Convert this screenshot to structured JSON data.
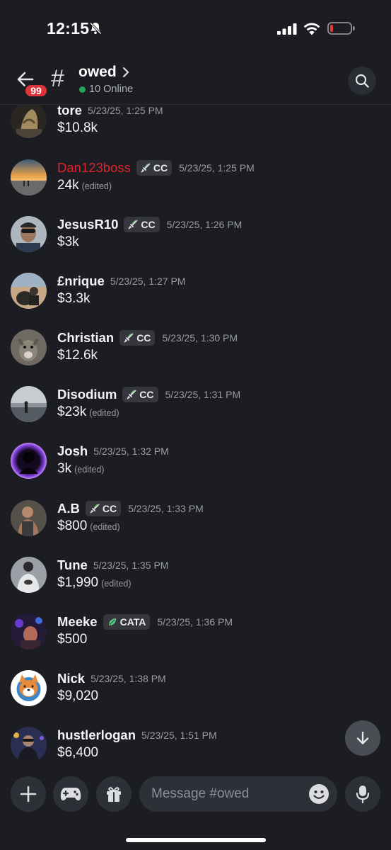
{
  "status_bar": {
    "time": "12:15"
  },
  "header": {
    "unread_badge": "99",
    "channel_name": "owed",
    "online_text": "10 Online"
  },
  "messages": [
    {
      "username": "tore",
      "name_color": "#f2f3f5",
      "tag": "",
      "timestamp": "5/23/25, 1:25 PM",
      "content": "$10.8k",
      "edited": ""
    },
    {
      "username": "Dan123boss",
      "name_color": "#e4212b",
      "tag": "CC",
      "timestamp": "5/23/25, 1:25 PM",
      "content": "24k",
      "edited": "(edited)"
    },
    {
      "username": "JesusR10",
      "name_color": "#f2f3f5",
      "tag": "CC",
      "timestamp": "5/23/25, 1:26 PM",
      "content": "$3k",
      "edited": ""
    },
    {
      "username": "£nrique",
      "name_color": "#f2f3f5",
      "tag": "",
      "timestamp": "5/23/25, 1:27 PM",
      "content": "$3.3k",
      "edited": ""
    },
    {
      "username": "Christian",
      "name_color": "#f2f3f5",
      "tag": "CC",
      "timestamp": "5/23/25, 1:30 PM",
      "content": "$12.6k",
      "edited": ""
    },
    {
      "username": "Disodium",
      "name_color": "#f2f3f5",
      "tag": "CC",
      "timestamp": "5/23/25, 1:31 PM",
      "content": "$23k",
      "edited": "(edited)"
    },
    {
      "username": "Josh",
      "name_color": "#f2f3f5",
      "tag": "",
      "timestamp": "5/23/25, 1:32 PM",
      "content": "3k",
      "edited": "(edited)"
    },
    {
      "username": "A.B",
      "name_color": "#f2f3f5",
      "tag": "CC",
      "timestamp": "5/23/25, 1:33 PM",
      "content": "$800",
      "edited": "(edited)"
    },
    {
      "username": "Tune",
      "name_color": "#f2f3f5",
      "tag": "",
      "timestamp": "5/23/25, 1:35 PM",
      "content": "$1,990",
      "edited": "(edited)"
    },
    {
      "username": "Meeke",
      "name_color": "#f2f3f5",
      "tag": "CATA",
      "timestamp": "5/23/25, 1:36 PM",
      "content": "$500",
      "edited": ""
    },
    {
      "username": "Nick",
      "name_color": "#f2f3f5",
      "tag": "",
      "timestamp": "5/23/25, 1:38 PM",
      "content": "$9,020",
      "edited": ""
    },
    {
      "username": "hustlerlogan",
      "name_color": "#f2f3f5",
      "tag": "",
      "timestamp": "5/23/25, 1:51 PM",
      "content": "$6,400",
      "edited": ""
    }
  ],
  "composer": {
    "placeholder": "Message #owed"
  },
  "colors": {
    "background": "#1c1d23",
    "online": "#23a55a",
    "badge": "#e0343b",
    "username_red": "#e4212b"
  },
  "icons": [
    "bell-off-icon",
    "signal-icon",
    "wifi-icon",
    "battery-low-icon",
    "back-arrow-icon",
    "hash-icon",
    "chevron-right-icon",
    "search-icon",
    "sword-icon",
    "leaf-icon",
    "arrow-down-icon",
    "plus-icon",
    "gamepad-icon",
    "gift-icon",
    "emoji-icon",
    "microphone-icon"
  ]
}
